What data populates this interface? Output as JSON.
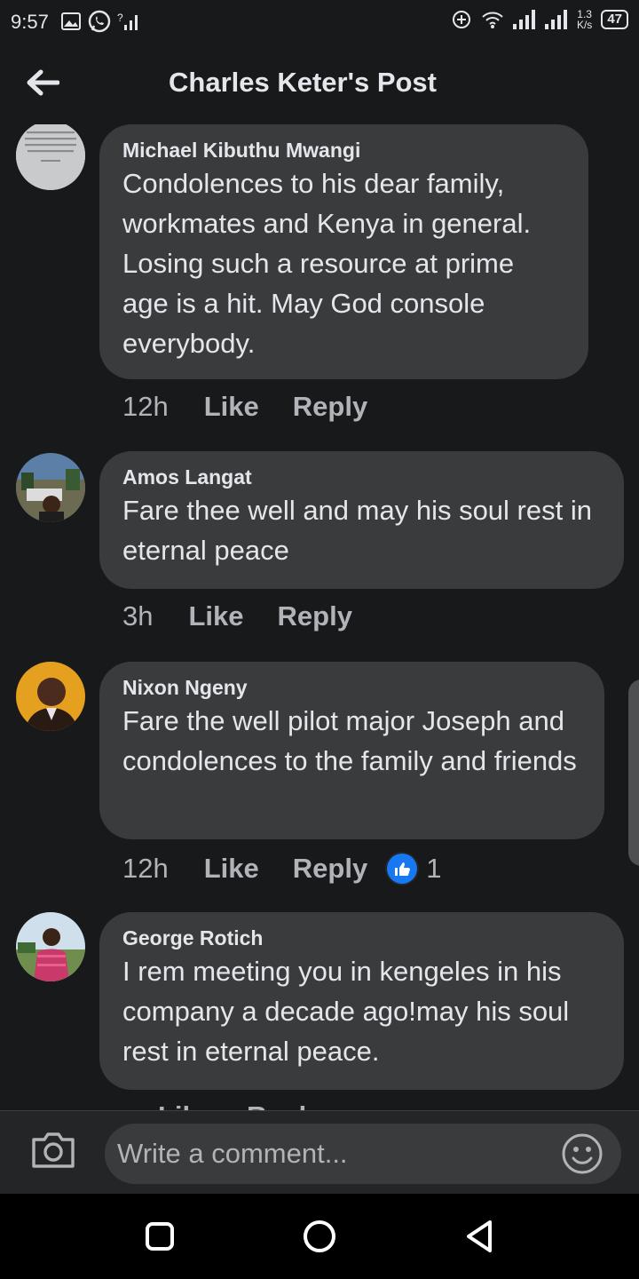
{
  "status_bar": {
    "time": "9:57",
    "speed": "1.3",
    "speed_unit": "K/s",
    "battery": "47"
  },
  "header": {
    "title": "Charles Keter's Post"
  },
  "comments": [
    {
      "author": "Michael Kibuthu Mwangi",
      "text": "Condolences to his dear family, workmates and Kenya in general. Losing such a resource at prime age is a hit. May God console everybody.",
      "time": "12h",
      "like_label": "Like",
      "reply_label": "Reply",
      "avatar_text": "I have made you and I will carry you; I will sustain you and I will rescue you."
    },
    {
      "author": "Amos Langat",
      "text": "Fare thee well and may his soul rest in eternal peace",
      "time": "3h",
      "like_label": "Like",
      "reply_label": "Reply"
    },
    {
      "author": "Nixon Ngeny",
      "text": "Fare the well pilot major Joseph and condolences to the family and friends",
      "time": "12h",
      "like_label": "Like",
      "reply_label": "Reply",
      "reaction_count": "1"
    },
    {
      "author": "George Rotich",
      "text": "I rem meeting you in kengeles in his company a decade ago!may his soul rest in eternal peace.",
      "time": "",
      "like_label": "Like",
      "reply_label": "Reply"
    }
  ],
  "composer": {
    "placeholder": "Write a comment..."
  },
  "colors": {
    "background": "#18191a",
    "bubble": "#3a3b3c",
    "text": "#e4e6eb",
    "secondary_text": "#b0b3b8",
    "like_blue": "#1877f2"
  }
}
